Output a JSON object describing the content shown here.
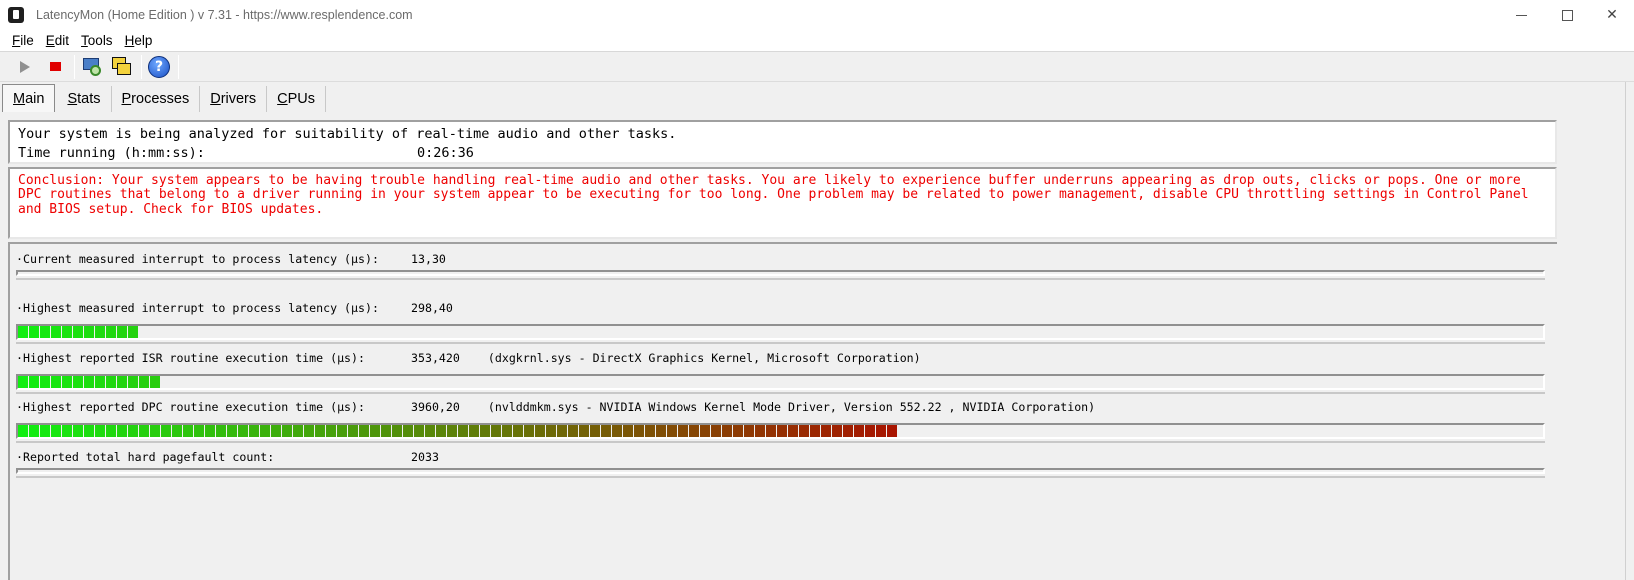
{
  "window": {
    "title": "LatencyMon  (Home Edition )  v 7.31 - https://www.resplendence.com"
  },
  "menu": [
    {
      "accel": "F",
      "rest": "ile"
    },
    {
      "accel": "E",
      "rest": "dit"
    },
    {
      "accel": "T",
      "rest": "ools"
    },
    {
      "accel": "H",
      "rest": "elp"
    }
  ],
  "toolbar": {
    "icons": [
      "play-icon",
      "stop-icon",
      "monitor-magnifier-icon",
      "windows-icon",
      "help-icon"
    ],
    "help_glyph": "?"
  },
  "tabs": [
    {
      "accel": "M",
      "rest": "ain",
      "active": true
    },
    {
      "accel": "S",
      "rest": "tats",
      "active": false
    },
    {
      "accel": "P",
      "rest": "rocesses",
      "active": false
    },
    {
      "accel": "D",
      "rest": "rivers",
      "active": false
    },
    {
      "accel": "C",
      "rest": "PUs",
      "active": false
    }
  ],
  "status": {
    "analyzing_text": "Your system is being analyzed for suitability of real-time audio and other tasks.",
    "time_label": "Time running (h:mm:ss):",
    "time_value": "0:26:36"
  },
  "conclusion": "Conclusion: Your system appears to be having trouble handling real-time audio and other tasks. You are likely to experience buffer underruns appearing as drop outs, clicks or pops. One or more DPC routines that belong to a driver running in your system appear to be executing for too long. One problem may be related to power management, disable CPU throttling settings in Control Panel and BIOS setup. Check for BIOS updates.",
  "metrics": [
    {
      "label": "·Current measured interrupt to process latency (µs):",
      "value": "13,30",
      "detail": "",
      "level": 0.0,
      "thin": true
    },
    {
      "label": "·Highest measured interrupt to process latency (µs):",
      "value": "298,40",
      "detail": "",
      "level": 0.082
    },
    {
      "label": "·Highest reported ISR routine execution time (µs):",
      "value": "353,420",
      "detail": "(dxgkrnl.sys - DirectX Graphics Kernel, Microsoft Corporation)",
      "level": 0.097
    },
    {
      "label": "·Highest reported DPC routine execution time (µs):",
      "value": "3960,20",
      "detail": "(nvlddmkm.sys - NVIDIA Windows Kernel Mode Driver, Version 552.22 , NVIDIA Corporation)",
      "level": 0.579
    },
    {
      "label": "·Reported total hard pagefault count:",
      "value": "2033",
      "detail": "",
      "level": 0.0,
      "thin": true
    }
  ],
  "colors": {
    "conclusion_text": "#ee0000",
    "bar_start": "#11ee11",
    "bar_end": "#aa1100"
  }
}
